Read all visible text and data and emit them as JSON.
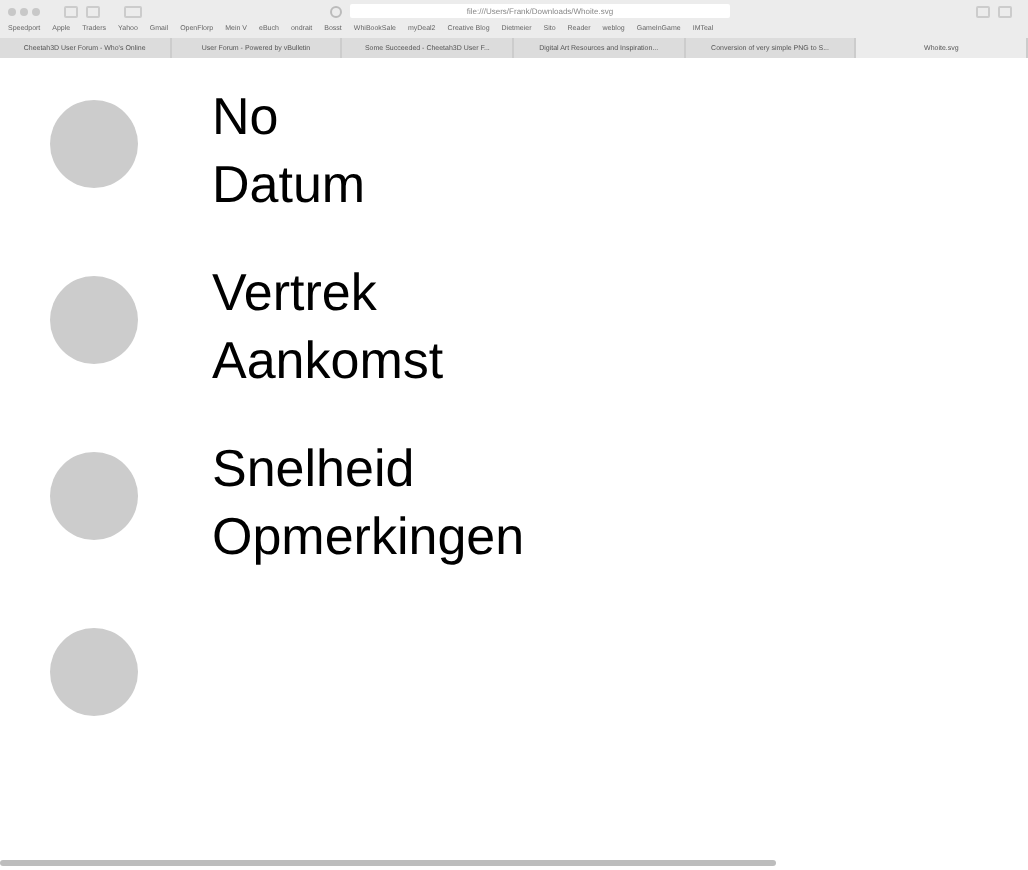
{
  "browser": {
    "url": "file:///Users/Frank/Downloads/Whoite.svg",
    "bookmarks": [
      "Speedport",
      "Apple",
      "Traders",
      "Yahoo",
      "Gmail",
      "OpenFlorp",
      "Mein V",
      "eBuch",
      "ondrait",
      "Bosst",
      "WhiBookSale",
      "myDeal2",
      "Creative Blog",
      "Dietmeier",
      "Sito",
      "Reader",
      "weblog",
      "GameInGame",
      "IMTeal"
    ],
    "tabs": [
      {
        "title": "Cheetah3D User Forum - Who's Online",
        "selected": false
      },
      {
        "title": "User Forum - Powered by vBulletin",
        "selected": false
      },
      {
        "title": "Some Succeeded - Cheetah3D User F...",
        "selected": false
      },
      {
        "title": "Digital Art Resources and Inspiration...",
        "selected": false
      },
      {
        "title": "Conversion of very simple PNG to S...",
        "selected": false
      },
      {
        "title": "Whoite.svg",
        "selected": true
      }
    ]
  },
  "rows": [
    {
      "kind": "labeled",
      "labels": [
        "No",
        "Datum"
      ]
    },
    {
      "kind": "labeled",
      "labels": [
        "Vertrek",
        "Aankomst"
      ]
    },
    {
      "kind": "labeled",
      "labels": [
        "Snelheid",
        "Opmerkingen"
      ]
    },
    {
      "kind": "blank"
    }
  ]
}
